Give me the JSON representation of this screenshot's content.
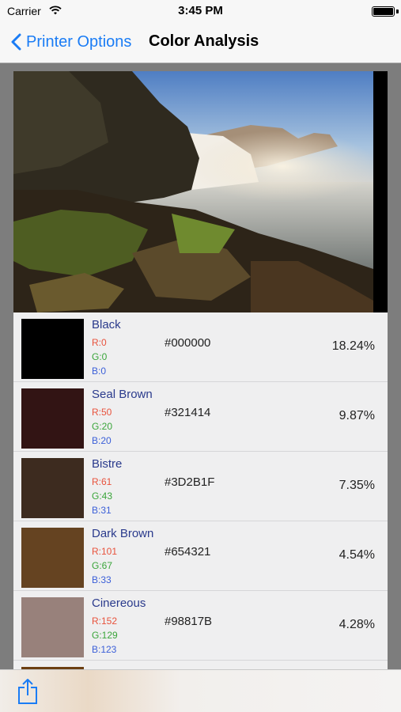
{
  "status_bar": {
    "carrier": "Carrier",
    "time": "3:45 PM"
  },
  "nav": {
    "back_label": "Printer Options",
    "title": "Color Analysis"
  },
  "colors": [
    {
      "name": "Black",
      "r": "R:0",
      "g": "G:0",
      "b": "B:0",
      "hex": "#000000",
      "percent": "18.24%",
      "swatch": "#000000"
    },
    {
      "name": "Seal Brown",
      "r": "R:50",
      "g": "G:20",
      "b": "B:20",
      "hex": "#321414",
      "percent": "9.87%",
      "swatch": "#321414"
    },
    {
      "name": "Bistre",
      "r": "R:61",
      "g": "G:43",
      "b": "B:31",
      "hex": "#3D2B1F",
      "percent": "7.35%",
      "swatch": "#3D2B1F"
    },
    {
      "name": "Dark Brown",
      "r": "R:101",
      "g": "G:67",
      "b": "B:33",
      "hex": "#654321",
      "percent": "4.54%",
      "swatch": "#654321"
    },
    {
      "name": "Cinereous",
      "r": "R:152",
      "g": "G:129",
      "b": "B:123",
      "hex": "#98817B",
      "percent": "4.28%",
      "swatch": "#98817B"
    }
  ],
  "icons": {
    "back": "chevron-left-icon",
    "share": "share-icon",
    "wifi": "wifi-icon",
    "battery": "battery-icon"
  }
}
